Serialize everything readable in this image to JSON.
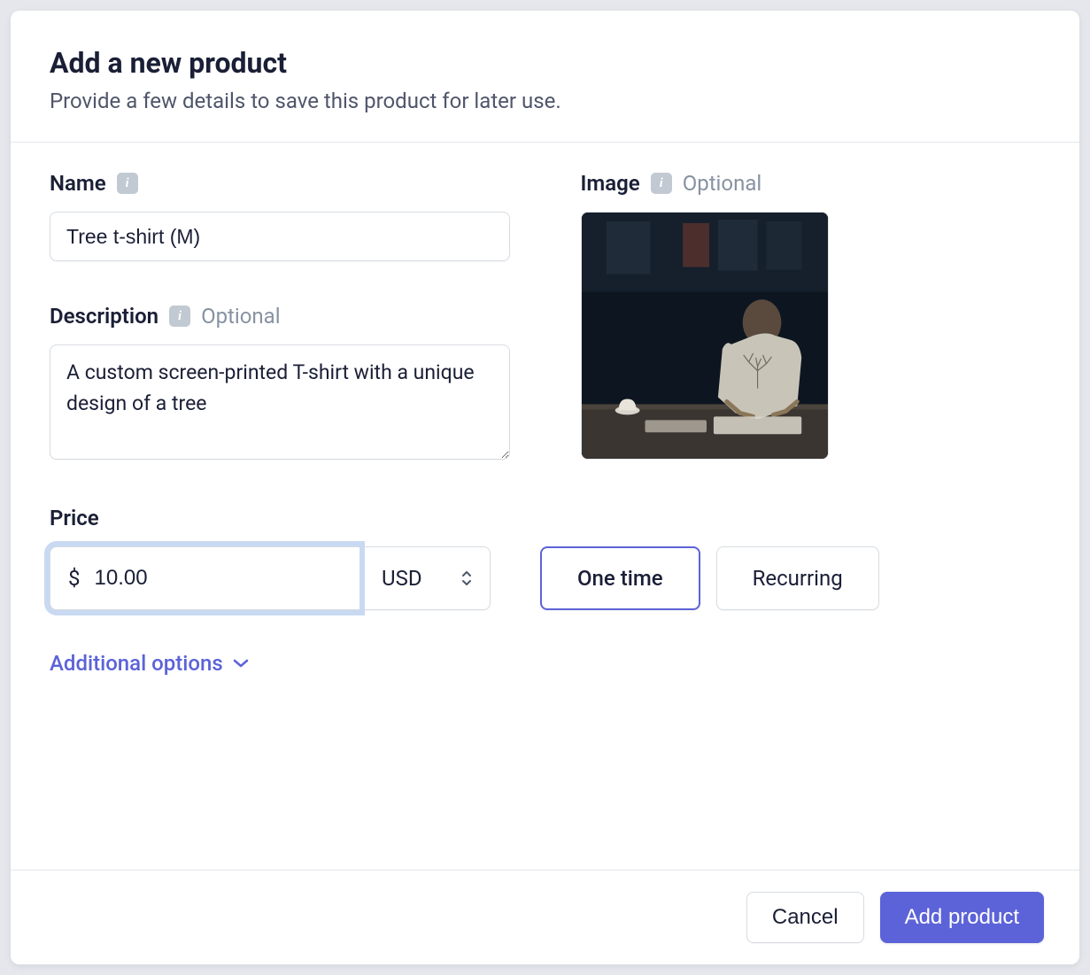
{
  "header": {
    "title": "Add a new product",
    "subtitle": "Provide a few details to save this product for later use."
  },
  "fields": {
    "name": {
      "label": "Name",
      "value": "Tree t-shirt (M)"
    },
    "description": {
      "label": "Description",
      "optional": "Optional",
      "value": "A custom screen-printed T-shirt with a unique design of a tree"
    },
    "image": {
      "label": "Image",
      "optional": "Optional"
    },
    "price": {
      "label": "Price",
      "currency_symbol": "$",
      "value": "10.00",
      "currency": "USD"
    },
    "billing": {
      "one_time": "One time",
      "recurring": "Recurring",
      "selected": "one_time"
    }
  },
  "additional_options": "Additional options",
  "footer": {
    "cancel": "Cancel",
    "add_product": "Add product"
  }
}
